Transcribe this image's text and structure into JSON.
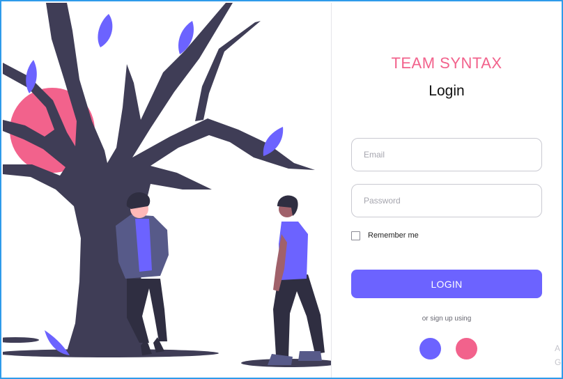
{
  "colors": {
    "accent": "#6c63ff",
    "brand": "#f2628c",
    "frame": "#2f9bea",
    "tree": "#3f3d56"
  },
  "illustration": {
    "name": "two-people-under-tree-illustration"
  },
  "login_panel": {
    "brand": "TEAM SYNTAX",
    "title": "Login",
    "email": {
      "placeholder": "Email",
      "value": ""
    },
    "password": {
      "placeholder": "Password",
      "value": ""
    },
    "remember": {
      "label": "Remember me",
      "checked": false
    },
    "login_button": "LOGIN",
    "signup_text": "or sign up using",
    "social_buttons": [
      "purple-circle-icon",
      "pink-circle-icon"
    ]
  },
  "watermark": {
    "line1": "A",
    "line2": "G"
  }
}
